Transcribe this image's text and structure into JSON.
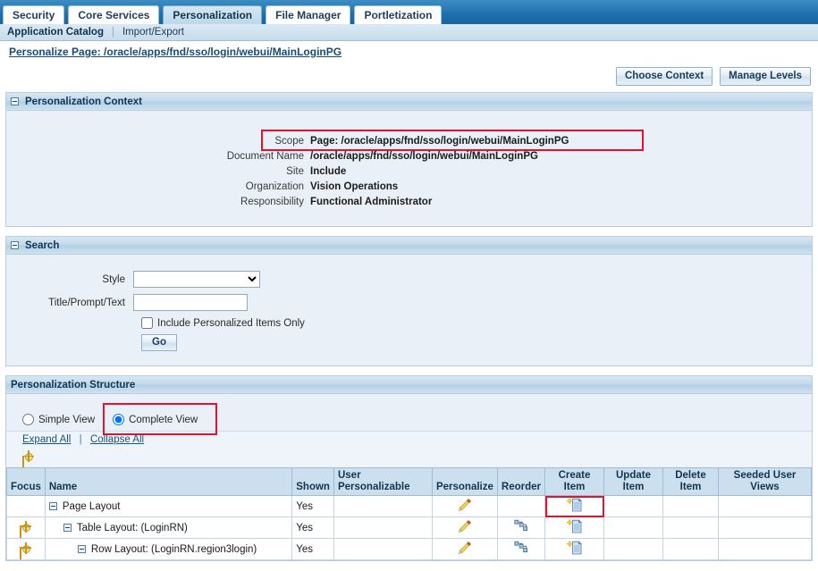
{
  "tabs": [
    {
      "label": "Security",
      "selected": false
    },
    {
      "label": "Core Services",
      "selected": false
    },
    {
      "label": "Personalization",
      "selected": true
    },
    {
      "label": "File Manager",
      "selected": false
    },
    {
      "label": "Portletization",
      "selected": false
    }
  ],
  "subnav": {
    "current": "Application Catalog",
    "separator": "|",
    "other": "Import/Export"
  },
  "page": {
    "title_prefix": "Personalize Page: ",
    "title_path": "/oracle/apps/fnd/sso/login/webui/MainLoginPG",
    "title_full": "Personalize Page: /oracle/apps/fnd/sso/login/webui/MainLoginPG"
  },
  "toolbar": {
    "choose_context": "Choose Context",
    "manage_levels": "Manage Levels"
  },
  "context": {
    "header": "Personalization Context",
    "rows": [
      {
        "label": "Scope",
        "value": "Page: /oracle/apps/fnd/sso/login/webui/MainLoginPG",
        "highlighted": true
      },
      {
        "label": "Document Name",
        "value": "/oracle/apps/fnd/sso/login/webui/MainLoginPG",
        "highlighted": false
      },
      {
        "label": "Site",
        "value": "Include",
        "highlighted": false
      },
      {
        "label": "Organization",
        "value": "Vision Operations",
        "highlighted": false
      },
      {
        "label": "Responsibility",
        "value": "Functional Administrator",
        "highlighted": false
      }
    ]
  },
  "search": {
    "header": "Search",
    "style_label": "Style",
    "style_value": "",
    "style_options": [
      ""
    ],
    "title_prompt_label": "Title/Prompt/Text",
    "title_prompt_value": "",
    "checkbox_label": "Include Personalized Items Only",
    "checkbox_checked": false,
    "go_label": "Go"
  },
  "structure": {
    "header": "Personalization Structure",
    "view_options": [
      {
        "label": "Simple View",
        "selected": false
      },
      {
        "label": "Complete View",
        "selected": true
      }
    ],
    "expand_all": "Expand All",
    "collapse_all": "Collapse All",
    "link_separator": "|",
    "columns": [
      "Focus",
      "Name",
      "Shown",
      "User Personalizable",
      "Personalize",
      "Reorder",
      "Create Item",
      "Update Item",
      "Delete Item",
      "Seeded User Views"
    ],
    "column_parts": {
      "user_personalizable_line1": "User",
      "user_personalizable_line2": "Personalizable",
      "create_line1": "Create",
      "create_line2": "Item",
      "update_line1": "Update",
      "update_line2": "Item",
      "delete_line1": "Delete",
      "delete_line2": "Item",
      "seeded_line1": "Seeded User",
      "seeded_line2": "Views"
    },
    "rows": [
      {
        "focus": false,
        "indent": 0,
        "name": "Page Layout",
        "shown": "Yes",
        "user_personalizable": "",
        "personalize": true,
        "reorder": false,
        "create_item": true,
        "update_item": false,
        "delete_item": false,
        "seeded_user_views": "",
        "create_highlighted": true
      },
      {
        "focus": true,
        "indent": 1,
        "name": "Table Layout: (LoginRN)",
        "shown": "Yes",
        "user_personalizable": "",
        "personalize": true,
        "reorder": true,
        "create_item": true,
        "update_item": false,
        "delete_item": false,
        "seeded_user_views": "",
        "create_highlighted": false
      },
      {
        "focus": true,
        "indent": 2,
        "name": "Row Layout: (LoginRN.region3login)",
        "shown": "Yes",
        "user_personalizable": "",
        "personalize": true,
        "reorder": true,
        "create_item": true,
        "update_item": false,
        "delete_item": false,
        "seeded_user_views": "",
        "create_highlighted": false
      }
    ]
  },
  "colors": {
    "tab_bar": "#1f6fae",
    "accent": "#15557f",
    "highlight_red": "#e8112d",
    "panel_bg": "#e9f0f7",
    "header_bg": "#ccdfee"
  },
  "icons": {
    "focus": "focus-target-icon",
    "personalize": "pencil-icon",
    "reorder": "reorder-icon",
    "create_item": "create-document-icon",
    "expander": "collapse-toggle-icon"
  }
}
